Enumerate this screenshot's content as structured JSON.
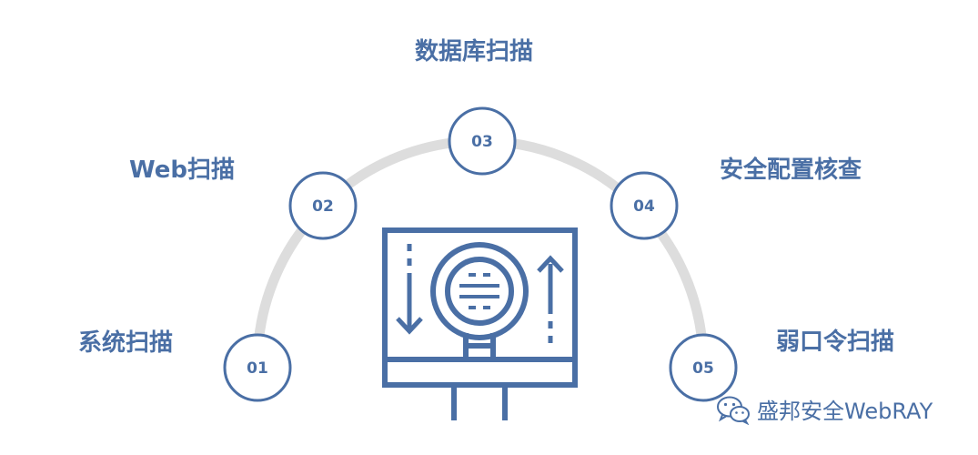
{
  "steps": [
    {
      "num": "01",
      "label": "系统扫描"
    },
    {
      "num": "02",
      "label": "Web扫描"
    },
    {
      "num": "03",
      "label": "数据库扫描"
    },
    {
      "num": "04",
      "label": "安全配置核查"
    },
    {
      "num": "05",
      "label": "弱口令扫描"
    }
  ],
  "watermark": {
    "text": "盛邦安全WebRAY",
    "icon": "wechat-icon"
  },
  "colors": {
    "accent": "#4a6fa5",
    "arc": "#dddddd",
    "node_fill": "#ffffff"
  },
  "center_icon": "magnifier-scan-icon"
}
